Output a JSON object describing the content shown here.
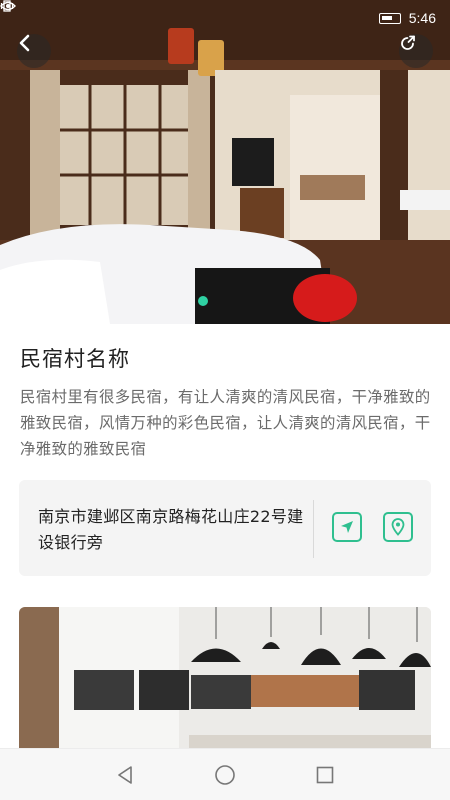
{
  "status_bar": {
    "time": "5:46",
    "icons": [
      "eye-icon",
      "vibrate-icon",
      "battery-icon"
    ]
  },
  "header": {
    "back_icon": "back-arrow-icon",
    "share_icon": "share-icon"
  },
  "hero": {
    "image": "guesthouse-bedroom-photo",
    "carousel_index": 1
  },
  "village": {
    "title": "民宿村名称",
    "description": "民宿村里有很多民宿，有让人清爽的清风民宿，干净雅致的雅致民宿，风情万种的彩色民宿，让人清爽的清风民宿，干净雅致的雅致民宿"
  },
  "address": {
    "text": "南京市建邺区南京路梅花山庄22号建 设银行旁",
    "navigate_icon": "navigate-arrow-icon",
    "location_icon": "location-pin-icon"
  },
  "gallery": {
    "image": "cafe-interior-photo"
  },
  "colors": {
    "accent": "#2fbf8f",
    "dot": "#2fd1a3",
    "card_bg": "#f4f4f4",
    "desc_text": "#6b6b6b"
  },
  "system_nav": {
    "icons": [
      "triangle-back-icon",
      "circle-home-icon",
      "square-recent-icon"
    ]
  }
}
